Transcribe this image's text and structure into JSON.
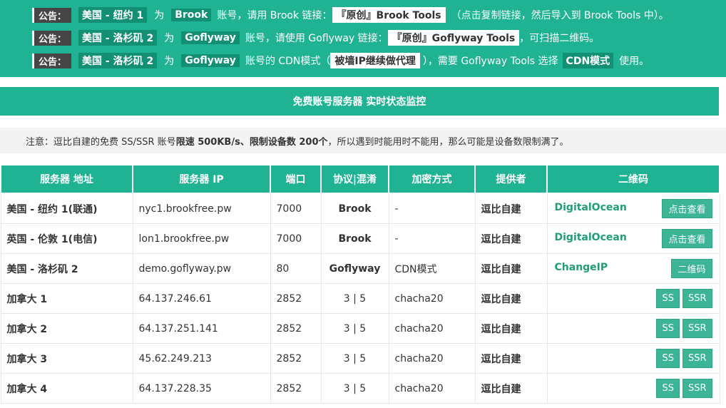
{
  "notices": [
    {
      "tag": "公告：",
      "parts": [
        "美国 - 纽约 1",
        "为",
        "Brook",
        "账号，请用 Brook 链接：",
        "『原创』Brook Tools",
        "（点击复制链接，然后导入到 Brook Tools 中）。"
      ]
    },
    {
      "tag": "公告：",
      "parts": [
        "美国 - 洛杉矶 2",
        "为",
        "Goflyway",
        "账号，请使用 Goflyway 链接：",
        "『原创』Goflyway Tools",
        "，可扫描二维码。"
      ]
    },
    {
      "tag": "公告：",
      "parts": [
        "美国 - 洛杉矶 2",
        "为",
        "Goflyway",
        "账号的 CDN模式（",
        "被墙IP继续做代理",
        "），需要 Goflyway Tools 选择",
        "CDN模式",
        "使用。"
      ]
    }
  ],
  "title": "免费账号服务器 实时状态监控",
  "note": {
    "prefix": "注意：逗比自建的免费 SS/SSR 账号",
    "speed": "限速 500KB/s",
    "sep": "、",
    "devices": "限制设备数 200个",
    "suffix": "，所以遇到时能用时不能用，那么可能是设备数限制满了。"
  },
  "table": {
    "headers": [
      "服务器 地址",
      "服务器 IP",
      "端口",
      "协议|混淆",
      "加密方式",
      "提供者",
      "二维码"
    ],
    "rows": [
      {
        "name": "美国 - 纽约 1(联通)",
        "ip": "nyc1.brookfree.pw",
        "port": "7000",
        "proto": "Brook",
        "enc": "-",
        "provider": "逗比自建",
        "qr_label": "DigitalOcean",
        "buttons": [
          "点击查看"
        ]
      },
      {
        "name": "英国 - 伦敦 1(电信)",
        "ip": "lon1.brookfree.pw",
        "port": "7000",
        "proto": "Brook",
        "enc": "-",
        "provider": "逗比自建",
        "qr_label": "DigitalOcean",
        "buttons": [
          "点击查看"
        ]
      },
      {
        "name": "美国 - 洛杉矶 2",
        "ip": "demo.goflyway.pw",
        "port": "80",
        "proto": "Goflyway",
        "enc": "CDN模式",
        "provider": "逗比自建",
        "qr_label": "ChangeIP",
        "buttons": [
          "二维码"
        ]
      },
      {
        "name": "加拿大 1",
        "ip": "64.137.246.61",
        "port": "2852",
        "proto": "3 | 5",
        "enc": "chacha20",
        "provider": "逗比自建",
        "qr_label": "",
        "buttons": [
          "SS",
          "SSR"
        ]
      },
      {
        "name": "加拿大 2",
        "ip": "64.137.251.141",
        "port": "2852",
        "proto": "3 | 5",
        "enc": "chacha20",
        "provider": "逗比自建",
        "qr_label": "",
        "buttons": [
          "SS",
          "SSR"
        ]
      },
      {
        "name": "加拿大 3",
        "ip": "45.62.249.213",
        "port": "2852",
        "proto": "3 | 5",
        "enc": "chacha20",
        "provider": "逗比自建",
        "qr_label": "",
        "buttons": [
          "SS",
          "SSR"
        ]
      },
      {
        "name": "加拿大 4",
        "ip": "64.137.228.35",
        "port": "2852",
        "proto": "3 | 5",
        "enc": "chacha20",
        "provider": "逗比自建",
        "qr_label": "",
        "buttons": [
          "SS",
          "SSR"
        ]
      }
    ]
  }
}
